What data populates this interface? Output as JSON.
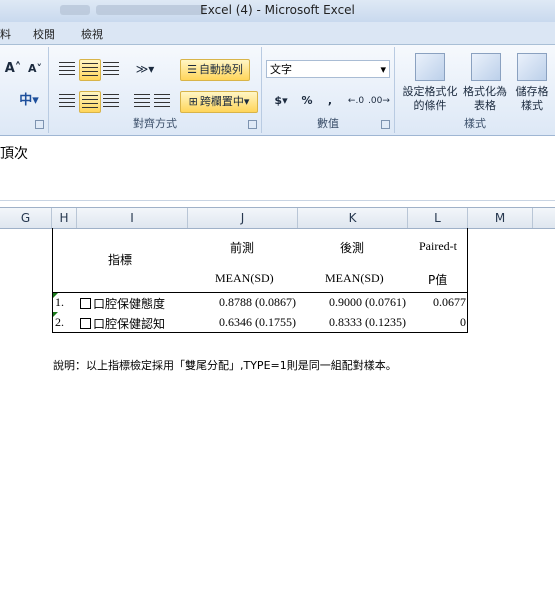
{
  "window": {
    "title": "Excel (4) - Microsoft Excel"
  },
  "menu_tabs": [
    "料",
    "校閱",
    "檢視"
  ],
  "ribbon": {
    "font": {
      "grow_label": "A",
      "shrink_label": "A",
      "phonetic_label": "中"
    },
    "alignment": {
      "wrap_text_label": "自動換列",
      "merge_center_label": "跨欄置中",
      "group_label": "對齊方式"
    },
    "number": {
      "format_value": "文字",
      "currency_label": "$",
      "percent_label": "%",
      "comma_label": ",",
      "group_label": "數值"
    },
    "styles": {
      "conditional_label_1": "設定格式化",
      "conditional_label_2": "的條件",
      "table_label_1": "格式化為",
      "table_label_2": "表格",
      "cell_styles_label_1": "儲存格",
      "cell_styles_label_2": "樣式",
      "group_label": "樣式"
    }
  },
  "formula_bar": {
    "content": "頂次"
  },
  "columns": [
    "G",
    "H",
    "I",
    "J",
    "K",
    "L",
    "M"
  ],
  "table": {
    "header": {
      "indicator": "指標",
      "pre": "前測",
      "post": "後測",
      "paired": "Paired-t",
      "pre_sub": "MEAN(SD)",
      "post_sub": "MEAN(SD)",
      "p_sub": "P值"
    },
    "rows": [
      {
        "no": "1.",
        "name": "口腔保健態度",
        "pre": "0.8788 (0.0867)",
        "post": "0.9000 (0.0761)",
        "p": "0.0677"
      },
      {
        "no": "2.",
        "name": "口腔保健認知",
        "pre": "0.6346 (0.1755)",
        "post": "0.8333 (0.1235)",
        "p": "0"
      }
    ]
  },
  "note": "說明：以上指標檢定採用「雙尾分配」,TYPE=1則是同一組配對樣本。"
}
